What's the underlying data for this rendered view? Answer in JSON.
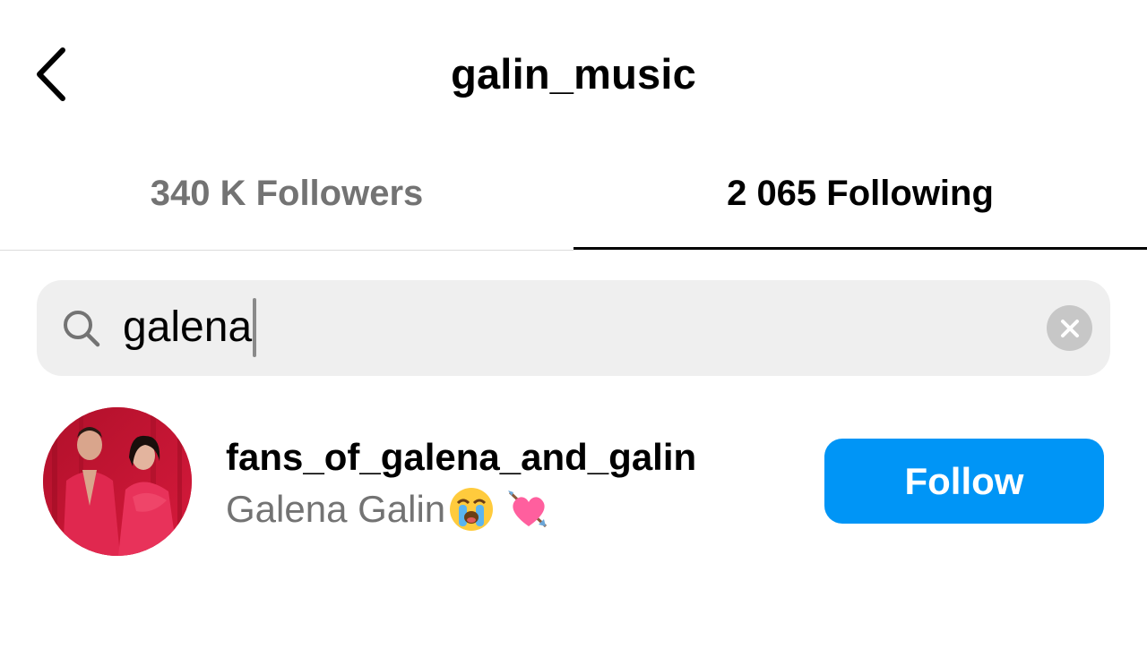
{
  "header": {
    "title": "galin_music",
    "back_icon": "chevron-left-icon"
  },
  "tabs": [
    {
      "label": "340 K Followers",
      "active": false
    },
    {
      "label": "2 065 Following",
      "active": true
    }
  ],
  "search": {
    "value": "galena",
    "icon": "search-icon",
    "clear_icon": "clear-icon"
  },
  "results": [
    {
      "username": "fans_of_galena_and_galin",
      "full_name": "Galena Galin",
      "emojis": [
        "loudly-crying-face-emoji",
        "heart-with-arrow-emoji"
      ],
      "button_label": "Follow"
    }
  ],
  "colors": {
    "accent": "#0095f6",
    "secondary_text": "#737373",
    "search_bg": "#efefef"
  }
}
